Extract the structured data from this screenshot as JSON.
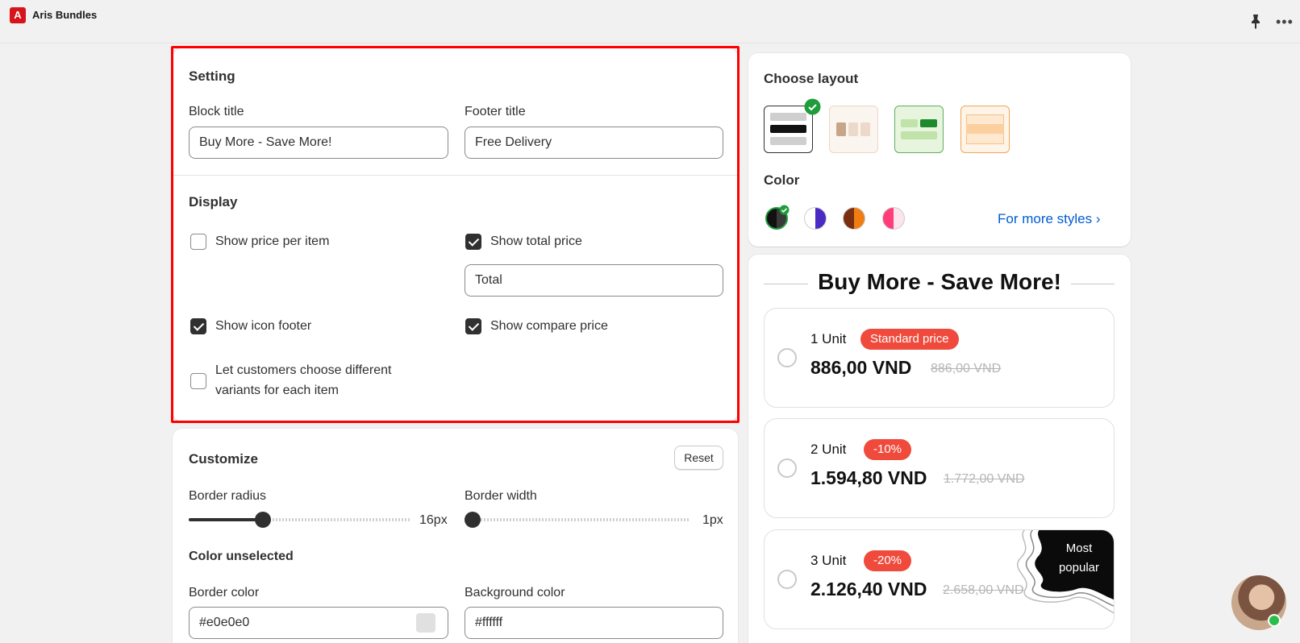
{
  "app": {
    "title": "Aris Bundles",
    "logo_letter": "A"
  },
  "setting": {
    "heading": "Setting",
    "block_title_label": "Block title",
    "block_title_value": "Buy More - Save More!",
    "footer_title_label": "Footer title",
    "footer_title_value": "Free Delivery"
  },
  "display": {
    "heading": "Display",
    "show_price_per_item": {
      "label": "Show price per item",
      "checked": false
    },
    "show_total_price": {
      "label": "Show total price",
      "checked": true
    },
    "total_value": "Total",
    "show_icon_footer": {
      "label": "Show icon footer",
      "checked": true
    },
    "show_compare_price": {
      "label": "Show compare price",
      "checked": true
    },
    "choose_variants": {
      "label_line1": "Let customers choose different",
      "label_line2": "variants for each item",
      "checked": false
    }
  },
  "customize": {
    "heading": "Customize",
    "reset_label": "Reset",
    "border_radius_label": "Border radius",
    "border_radius_value": "16px",
    "border_width_label": "Border width",
    "border_width_value": "1px",
    "color_unselected_heading": "Color unselected",
    "border_color_label": "Border color",
    "border_color_value": "#e0e0e0",
    "background_color_label": "Background color",
    "background_color_value": "#ffffff"
  },
  "layout": {
    "heading": "Choose layout",
    "selected_index": 0,
    "color_heading": "Color",
    "colors": [
      {
        "left": "#111111",
        "right": "#3a3a3a",
        "selected": true
      },
      {
        "left": "#ffffff",
        "right": "#4a2bc4",
        "selected": false
      },
      {
        "left": "#7a2f10",
        "right": "#f07d12",
        "selected": false
      },
      {
        "left": "#ff3d7a",
        "right": "#fde3ec",
        "selected": false
      }
    ],
    "more_styles": "For more styles"
  },
  "preview": {
    "title": "Buy More - Save More!",
    "options": [
      {
        "unit": "1 Unit",
        "badge": "Standard price",
        "price": "886,00 VND",
        "compare": "886,00 VND"
      },
      {
        "unit": "2 Unit",
        "badge": "-10%",
        "price": "1.594,80 VND",
        "compare": "1.772,00 VND"
      },
      {
        "unit": "3 Unit",
        "badge": "-20%",
        "price": "2.126,40 VND",
        "compare": "2.658,00 VND",
        "ribbon_line1": "Most",
        "ribbon_line2": "popular"
      }
    ]
  },
  "colors": {
    "accent_red": "#ef4a3c",
    "link_blue": "#005bd3",
    "selected_green": "#1f9d3a"
  }
}
